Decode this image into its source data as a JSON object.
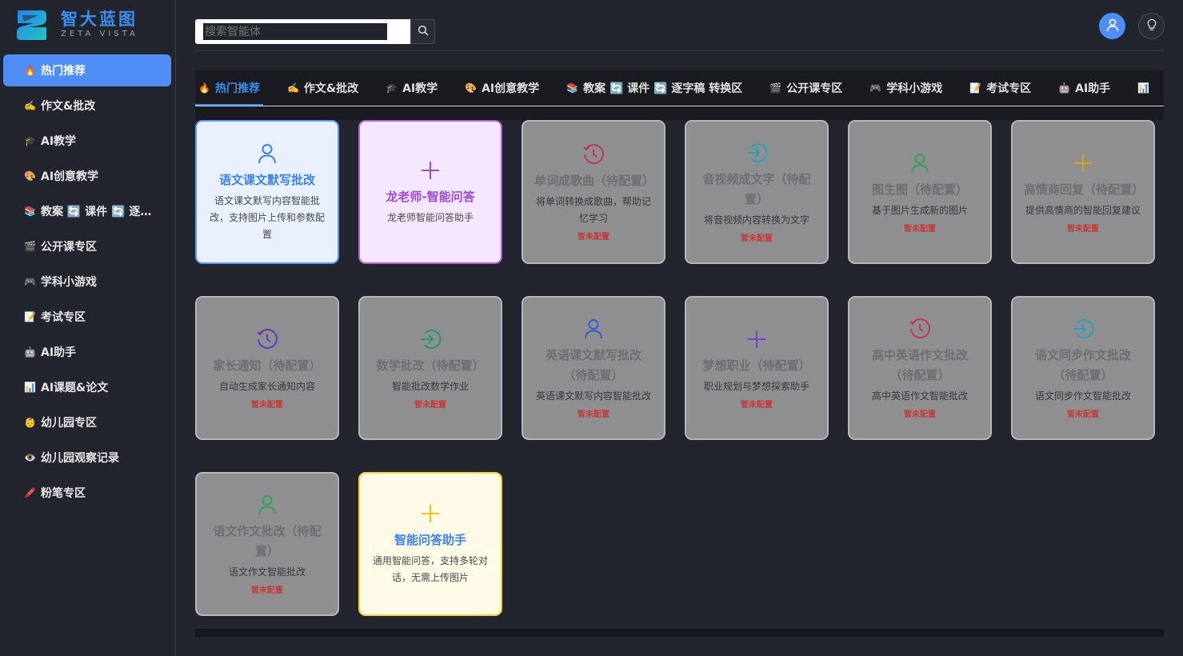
{
  "brand": {
    "title": "智大蓝图",
    "subtitle": "ZETA VISTA"
  },
  "search": {
    "placeholder": "搜索智能体"
  },
  "sidebar": {
    "items": [
      {
        "emoji": "🔥",
        "label": "热门推荐",
        "active": true
      },
      {
        "emoji": "✍️",
        "label": "作文&批改"
      },
      {
        "emoji": "🎓",
        "label": "AI教学"
      },
      {
        "emoji": "🎨",
        "label": "AI创意教学"
      },
      {
        "emoji": "📚",
        "label": "教案 🔄 课件 🔄 逐字稿..."
      },
      {
        "emoji": "🎬",
        "label": "公开课专区"
      },
      {
        "emoji": "🎮",
        "label": "学科小游戏"
      },
      {
        "emoji": "📝",
        "label": "考试专区"
      },
      {
        "emoji": "🤖",
        "label": "AI助手"
      },
      {
        "emoji": "📊",
        "label": "AI课题&论文"
      },
      {
        "emoji": "👶",
        "label": "幼儿园专区"
      },
      {
        "emoji": "👁️",
        "label": "幼儿园观察记录"
      },
      {
        "emoji": "🖍️",
        "label": "粉笔专区"
      }
    ]
  },
  "tabs": [
    {
      "emoji": "🔥",
      "label": "热门推荐",
      "active": true
    },
    {
      "emoji": "✍️",
      "label": "作文&批改"
    },
    {
      "emoji": "🎓",
      "label": "AI教学"
    },
    {
      "emoji": "🎨",
      "label": "AI创意教学"
    },
    {
      "emoji": "📚",
      "label": "教案 🔄 课件 🔄 逐字稿 转换区"
    },
    {
      "emoji": "🎬",
      "label": "公开课专区"
    },
    {
      "emoji": "🎮",
      "label": "学科小游戏"
    },
    {
      "emoji": "📝",
      "label": "考试专区"
    },
    {
      "emoji": "🤖",
      "label": "AI助手"
    },
    {
      "emoji": "📊",
      "label": ""
    }
  ],
  "tab_more": "···",
  "status_unconfigured": "暂未配置",
  "cards": [
    {
      "title": "语文课文默写批改",
      "desc": "语文课文默写内容智能批改，支持图片上传和参数配置",
      "icon": "user-icon",
      "theme": "blue",
      "color": "#3b82f0"
    },
    {
      "title": "龙老师-智能问答",
      "desc": "龙老师智能问答助手",
      "icon": "plus-icon",
      "theme": "purple",
      "color": "#a04ad6"
    },
    {
      "title": "单词成歌曲（待配置）",
      "desc": "将单词转换成歌曲，帮助记忆学习",
      "icon": "history-icon",
      "theme": "gray",
      "color": "#c4345a",
      "status": "暂未配置"
    },
    {
      "title": "音视频成文字（待配置）",
      "desc": "将音视频内容转换为文字",
      "icon": "login-icon",
      "theme": "gray",
      "color": "#2a9fbf",
      "status": "暂未配置"
    },
    {
      "title": "图生图（待配置）",
      "desc": "基于图片生成新的图片",
      "icon": "user-icon",
      "theme": "gray",
      "color": "#2fa35a",
      "status": "暂未配置"
    },
    {
      "title": "高情商回复（待配置）",
      "desc": "提供高情商的智能回复建议",
      "icon": "plus-icon",
      "theme": "gray",
      "color": "#d6a21a",
      "status": "暂未配置"
    },
    {
      "title": "家长通知（待配置）",
      "desc": "自动生成家长通知内容",
      "icon": "history-icon",
      "theme": "gray",
      "color": "#5a3fbf",
      "status": "暂未配置"
    },
    {
      "title": "数学批改（待配置）",
      "desc": "智能批改数学作业",
      "icon": "login-icon",
      "theme": "gray",
      "color": "#1f9a6a",
      "status": "暂未配置"
    },
    {
      "title": "英语课文默写批改（待配置）",
      "desc": "英语课文默写内容智能批改",
      "icon": "user-icon",
      "theme": "gray",
      "color": "#2f5fcf",
      "status": "暂未配置"
    },
    {
      "title": "梦想职业（待配置）",
      "desc": "职业规划与梦想探索助手",
      "icon": "plus-icon",
      "theme": "gray",
      "color": "#7a3fcf",
      "status": "暂未配置"
    },
    {
      "title": "高中英语作文批改（待配置）",
      "desc": "高中英语作文智能批改",
      "icon": "history-icon",
      "theme": "gray",
      "color": "#c4345a",
      "status": "暂未配置"
    },
    {
      "title": "语文同步作文批改（待配置）",
      "desc": "语文同步作文智能批改",
      "icon": "login-icon",
      "theme": "gray",
      "color": "#2a9fbf",
      "status": "暂未配置"
    },
    {
      "title": "语文作文批改（待配置）",
      "desc": "语文作文智能批改",
      "icon": "user-icon",
      "theme": "gray",
      "color": "#2fa35a",
      "status": "暂未配置"
    },
    {
      "title": "智能问答助手",
      "desc": "通用智能问答，支持多轮对话，无需上传图片",
      "icon": "plus-icon",
      "theme": "yellow",
      "color": "#f2c21a"
    }
  ]
}
